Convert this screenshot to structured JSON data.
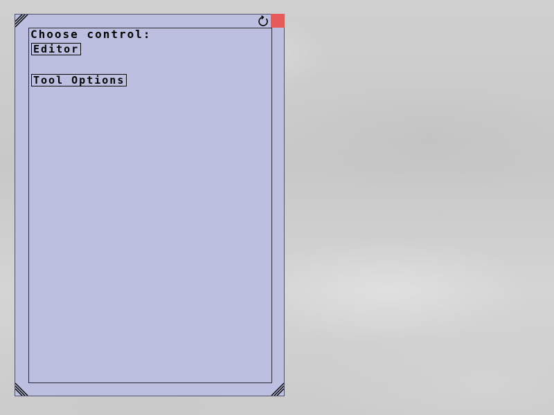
{
  "panel": {
    "prompt_label": "Choose control:",
    "buttons": [
      {
        "label": "Editor"
      },
      {
        "label": "Tool Options"
      }
    ]
  },
  "titlebar": {
    "refresh_icon": "refresh-icon",
    "close_icon": "close-icon"
  },
  "colors": {
    "window_bg": "#bcbfdf",
    "close_button": "#e85a5a",
    "desktop_bg": "#cfcfcf"
  }
}
